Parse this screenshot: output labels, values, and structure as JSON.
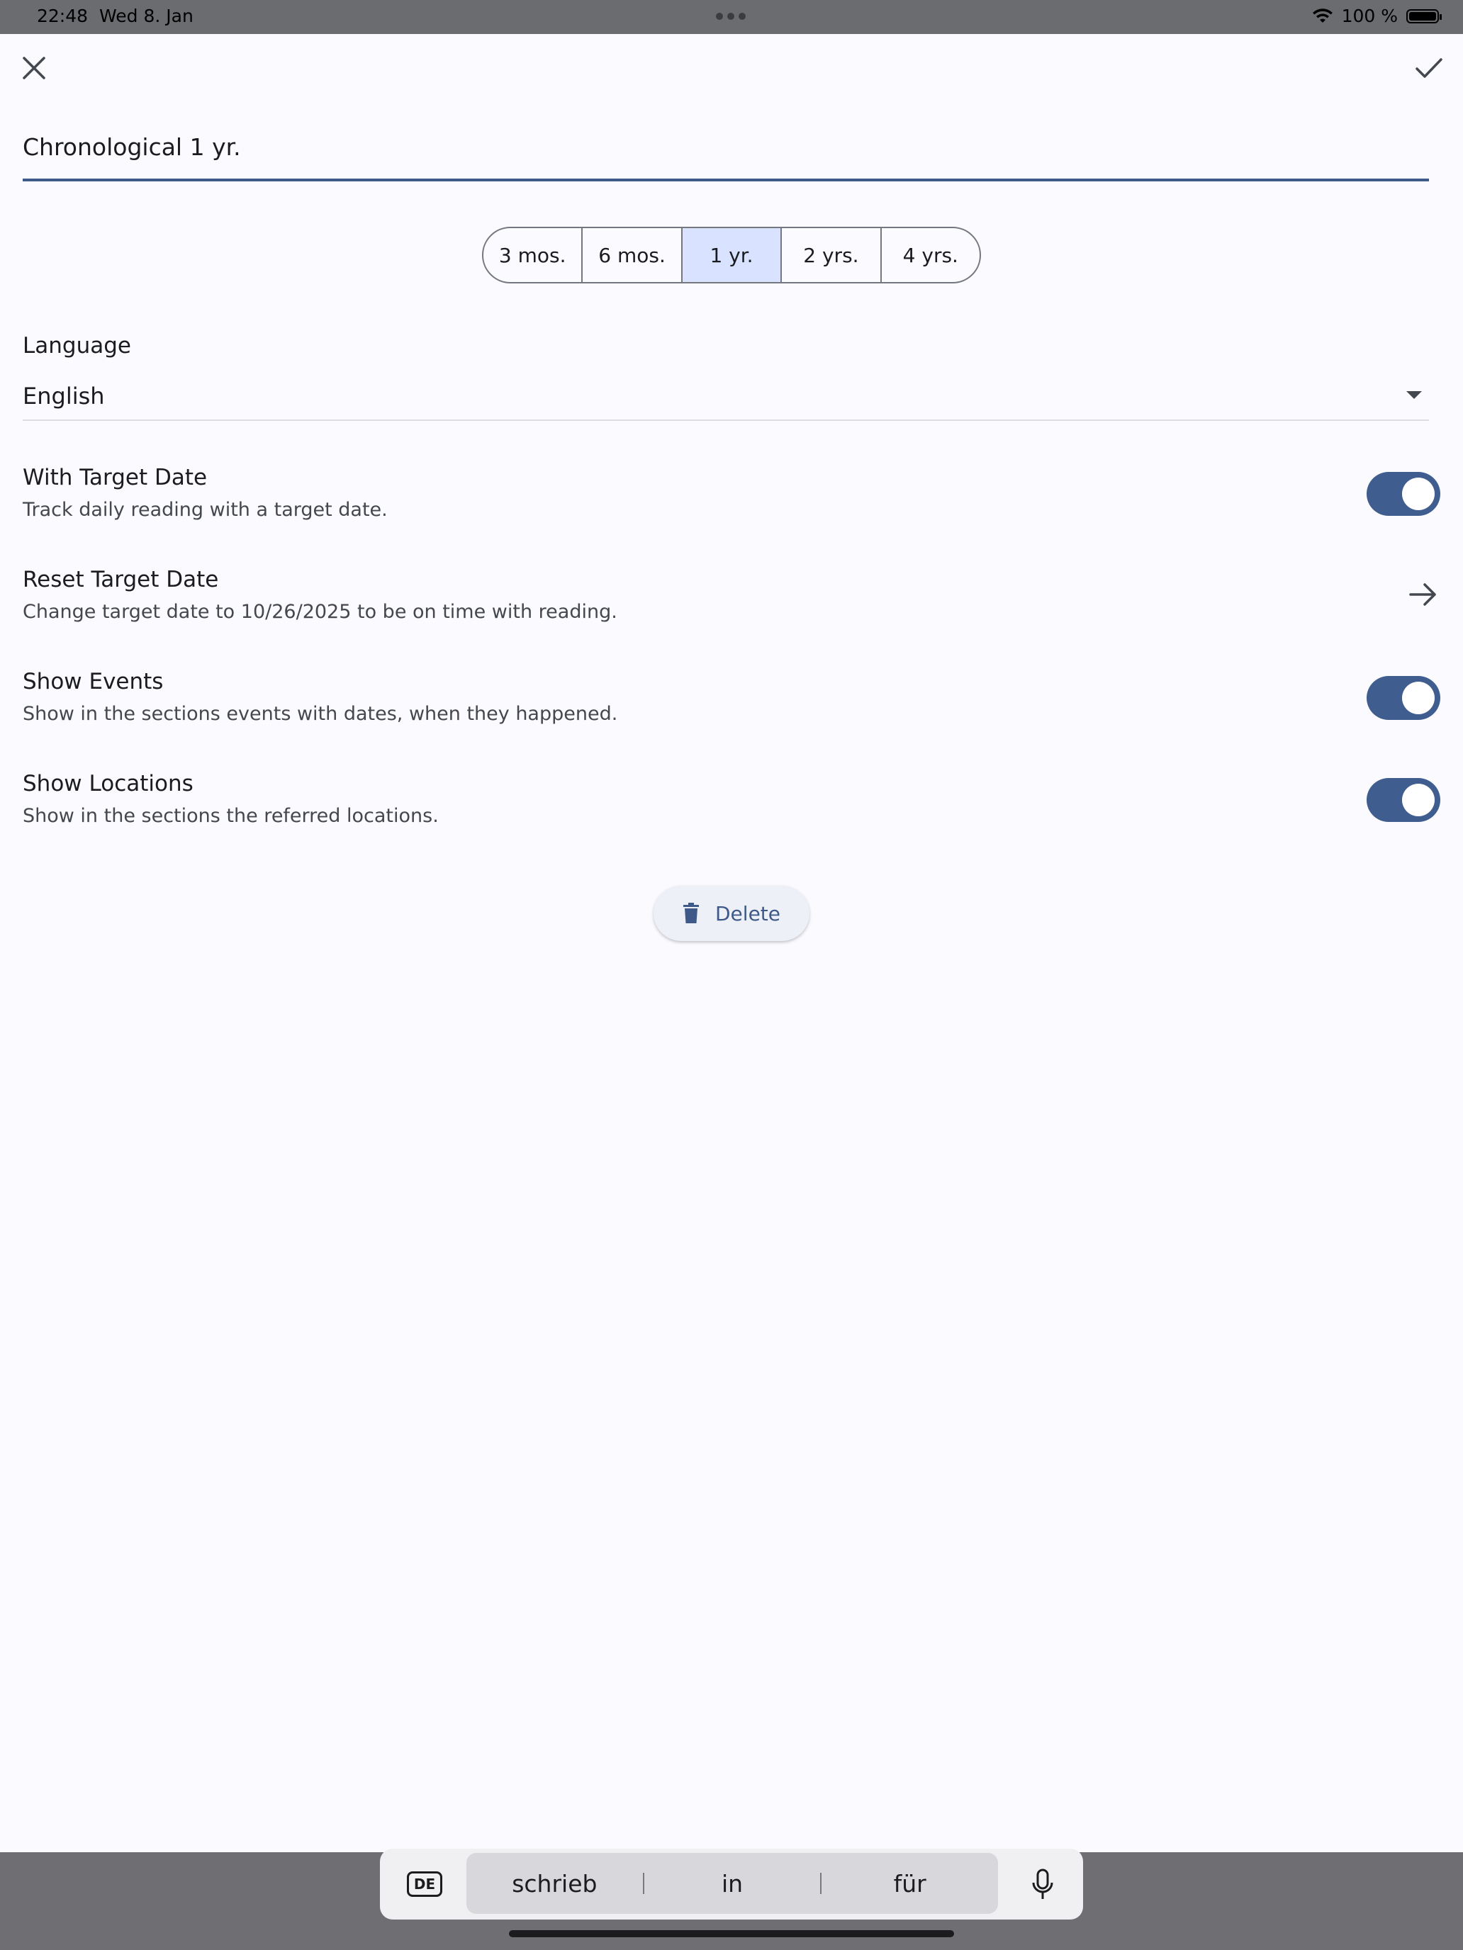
{
  "status_bar": {
    "time": "22:48",
    "date": "Wed 8. Jan",
    "battery": "100 %"
  },
  "header": {
    "close_icon": "close-icon",
    "confirm_icon": "check-icon"
  },
  "title_field": {
    "value": "Chronological 1 yr."
  },
  "duration_segments": {
    "options": [
      "3 mos.",
      "6 mos.",
      "1 yr.",
      "2 yrs.",
      "4 yrs."
    ],
    "selected": "1 yr."
  },
  "language": {
    "label": "Language",
    "value": "English"
  },
  "settings": {
    "target_date": {
      "title": "With Target Date",
      "subtitle": "Track daily reading with a target date.",
      "enabled": true
    },
    "reset_target": {
      "title": "Reset Target Date",
      "subtitle": "Change target date to 10/26/2025 to be on time with reading."
    },
    "show_events": {
      "title": "Show Events",
      "subtitle": "Show in the sections events with dates, when they happened.",
      "enabled": true
    },
    "show_locations": {
      "title": "Show Locations",
      "subtitle": "Show in the sections the referred locations.",
      "enabled": true
    }
  },
  "delete_button": {
    "label": "Delete"
  },
  "keyboard": {
    "language_key": "DE",
    "suggestions": [
      "schrieb",
      "in",
      "für"
    ]
  },
  "colors": {
    "accent": "#405d90",
    "segment_selected": "#d9e2ff",
    "background": "#fafaff"
  }
}
